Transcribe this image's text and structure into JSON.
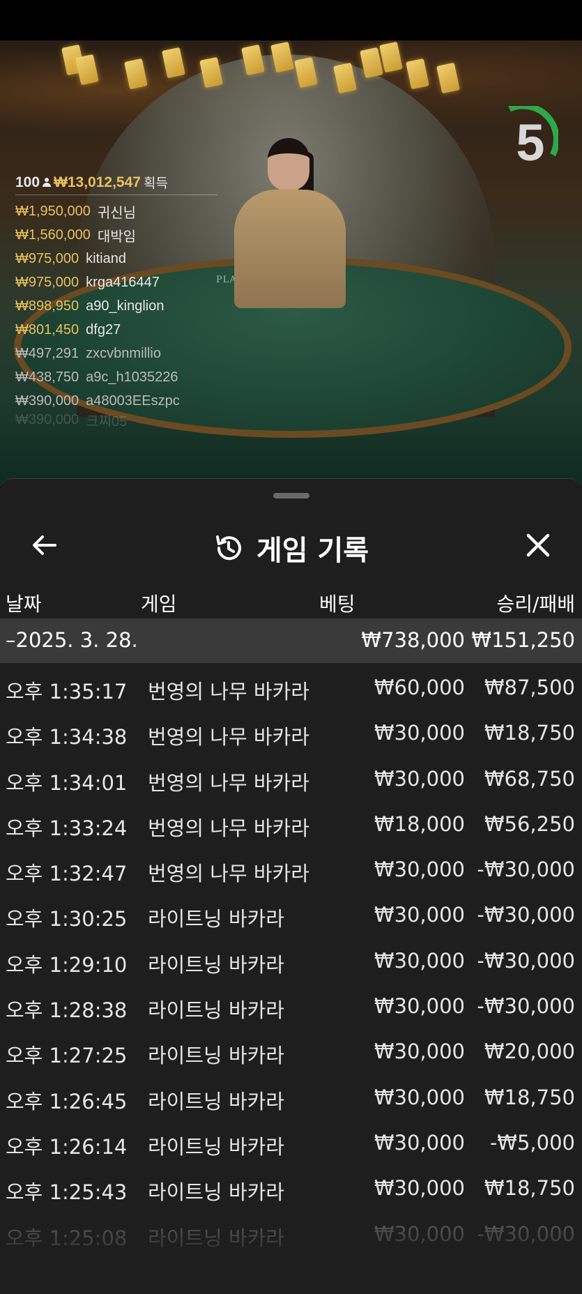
{
  "timer": {
    "value": "5"
  },
  "leaderboard": {
    "player_count": "100",
    "total": "₩13,012,547",
    "gain_label": "획득",
    "rows": [
      {
        "amount": "₩1,950,000",
        "name": "귀신님"
      },
      {
        "amount": "₩1,560,000",
        "name": "대박임"
      },
      {
        "amount": "₩975,000",
        "name": "kitiand"
      },
      {
        "amount": "₩975,000",
        "name": "krga416447"
      },
      {
        "amount": "₩898,950",
        "name": "a90_kinglion"
      },
      {
        "amount": "₩801,450",
        "name": "dfg27"
      },
      {
        "amount": "₩497,291",
        "name": "zxcvbnmillio"
      },
      {
        "amount": "₩438,750",
        "name": "a9c_h1035226"
      },
      {
        "amount": "₩390,000",
        "name": "a48003EEszpc"
      },
      {
        "amount": "₩390,000",
        "name": "크찌05"
      }
    ]
  },
  "table": {
    "label": "PLAYER          BANKER"
  },
  "sheet": {
    "title": "게임 기록",
    "columns": {
      "date": "날짜",
      "game": "게임",
      "bet": "베팅",
      "result": "승리/패배"
    },
    "summary": {
      "date": "–2025. 3. 28.",
      "bet": "₩738,000",
      "result": "₩151,250"
    },
    "rows": [
      {
        "time": "오후 1:35:17",
        "game": "번영의 나무 바카라",
        "bet": "₩60,000",
        "result": "₩87,500"
      },
      {
        "time": "오후 1:34:38",
        "game": "번영의 나무 바카라",
        "bet": "₩30,000",
        "result": "₩18,750"
      },
      {
        "time": "오후 1:34:01",
        "game": "번영의 나무 바카라",
        "bet": "₩30,000",
        "result": "₩68,750"
      },
      {
        "time": "오후 1:33:24",
        "game": "번영의 나무 바카라",
        "bet": "₩18,000",
        "result": "₩56,250"
      },
      {
        "time": "오후 1:32:47",
        "game": "번영의 나무 바카라",
        "bet": "₩30,000",
        "result": "-₩30,000"
      },
      {
        "time": "오후 1:30:25",
        "game": "라이트닝 바카라",
        "bet": "₩30,000",
        "result": "-₩30,000"
      },
      {
        "time": "오후 1:29:10",
        "game": "라이트닝 바카라",
        "bet": "₩30,000",
        "result": "-₩30,000"
      },
      {
        "time": "오후 1:28:38",
        "game": "라이트닝 바카라",
        "bet": "₩30,000",
        "result": "-₩30,000"
      },
      {
        "time": "오후 1:27:25",
        "game": "라이트닝 바카라",
        "bet": "₩30,000",
        "result": "₩20,000"
      },
      {
        "time": "오후 1:26:45",
        "game": "라이트닝 바카라",
        "bet": "₩30,000",
        "result": "₩18,750"
      },
      {
        "time": "오후 1:26:14",
        "game": "라이트닝 바카라",
        "bet": "₩30,000",
        "result": "-₩5,000"
      },
      {
        "time": "오후 1:25:43",
        "game": "라이트닝 바카라",
        "bet": "₩30,000",
        "result": "₩18,750"
      },
      {
        "time": "오후 1:25:08",
        "game": "라이트닝 바카라",
        "bet": "₩30,000",
        "result": "-₩30,000"
      }
    ]
  },
  "colors": {
    "gold": "#e8c060",
    "timer_ring": "#2ea84a",
    "sheet_bg": "#1e1e1e",
    "summary_bg": "#3a3a3a"
  }
}
